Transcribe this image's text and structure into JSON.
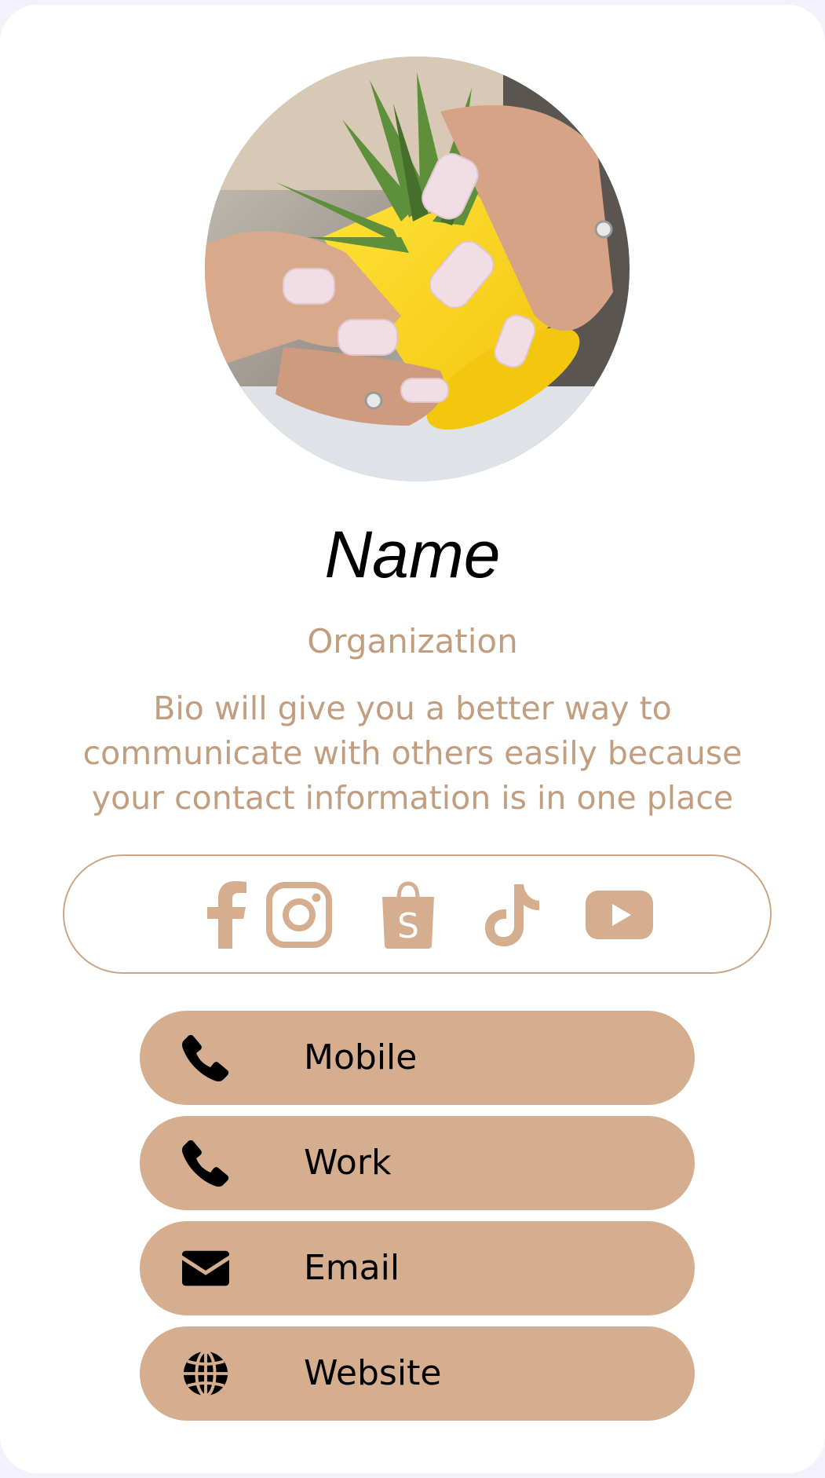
{
  "profile": {
    "avatar_description": "hands with manicured nails holding a yellow pot with a succulent",
    "name": "Name",
    "organization": "Organization",
    "bio": "Bio will give you a better way to\ncommunicate with others easily because\nyour contact information is in one place"
  },
  "social_links": [
    {
      "icon": "facebook-icon"
    },
    {
      "icon": "instagram-icon"
    },
    {
      "icon": "shopify-icon"
    },
    {
      "icon": "tiktok-icon"
    },
    {
      "icon": "youtube-icon"
    }
  ],
  "contact_buttons": [
    {
      "label": "Mobile",
      "icon": "phone-icon"
    },
    {
      "label": "Work",
      "icon": "phone-icon"
    },
    {
      "label": "Email",
      "icon": "envelope-icon"
    },
    {
      "label": "Website",
      "icon": "globe-icon"
    }
  ],
  "colors": {
    "accent": "#d4ae8e",
    "accent_text": "#c19e80",
    "background": "#f3f1fb",
    "card": "#ffffff"
  }
}
